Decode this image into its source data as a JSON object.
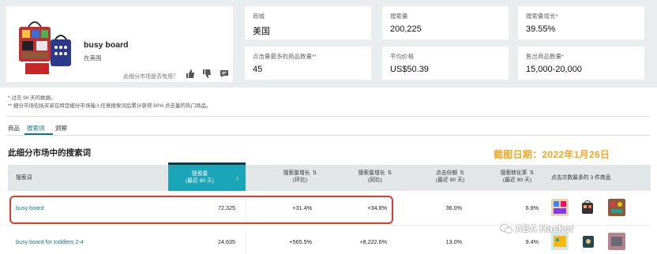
{
  "product": {
    "title": "busy board",
    "market": "在美国",
    "help_text": "此细分市场是否有用？"
  },
  "metrics": [
    {
      "label": "商城",
      "value": "美国"
    },
    {
      "label": "搜索量",
      "value": "200,225"
    },
    {
      "label": "搜索量增长*",
      "value": "39.55%"
    },
    {
      "label": "点击量最多的商品数量**",
      "value": "45"
    },
    {
      "label": "平均价格",
      "value": "US$50.39"
    },
    {
      "label": "售出商品数量*",
      "value": "15,000-20,000"
    }
  ],
  "notes": [
    "* 过去 90 天的数据。",
    "** 细分市场包括买家在特定细分市场输入任意搜索词后累计获得 80% 点击量的热门商品。"
  ],
  "tabs": [
    "商品",
    "搜索词",
    "洞察"
  ],
  "section_title": "此细分市场中的搜索词",
  "screenshot_date": "截图日期：2022年1月26日",
  "table": {
    "headers": {
      "term": "搜索词",
      "volume": "搜索量",
      "volume_sub": "(最近 90 天)",
      "growth_90": "搜索量增长",
      "growth_90_sub": "(环比)",
      "growth_yoy": "搜索量增长",
      "growth_yoy_sub": "(同比)",
      "click_share": "点击份额",
      "click_share_sub": "(最近 90 天)",
      "conversion": "搜索转化率",
      "conversion_sub": "(最近 90 天)",
      "top_clicked": "点击次数最多的 3 件商品"
    },
    "rows": [
      {
        "term": "busy board",
        "volume": "72,325",
        "growth_90": "+31.4%",
        "growth_yoy": "+34.8%",
        "click_share": "36.0%",
        "conversion": "6.9%"
      },
      {
        "term": "busy board for toddlers 2-4",
        "volume": "24,635",
        "growth_90": "+565.5%",
        "growth_yoy": "+8,222.6%",
        "click_share": "13.0%",
        "conversion": "9.4%"
      }
    ]
  },
  "watermark": "ABA Hacker",
  "colors": {
    "accent": "#1aa5b8",
    "link": "#0b7b8c",
    "date": "#f5a623",
    "highlight": "#e03a2f"
  }
}
